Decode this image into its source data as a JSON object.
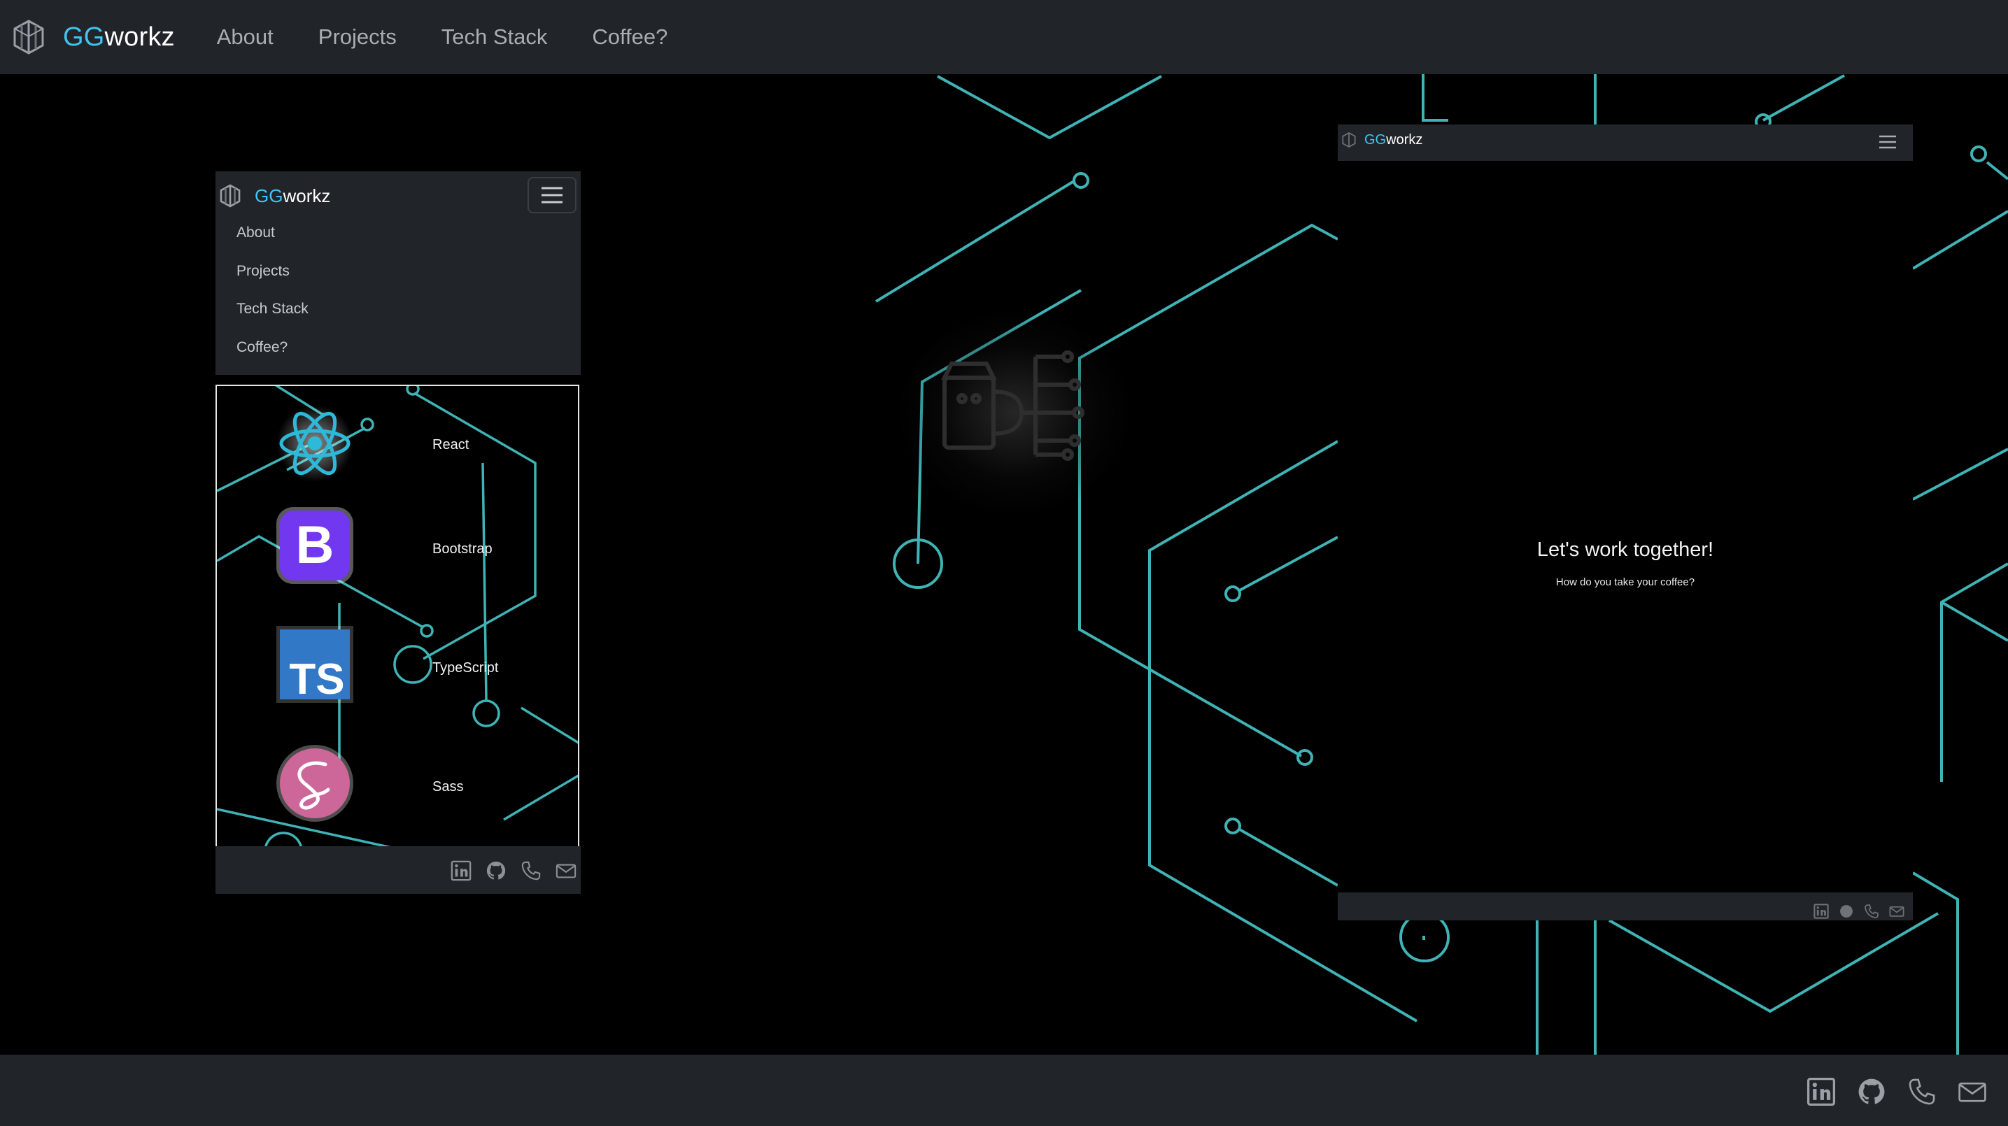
{
  "navbar": {
    "brand_gg": "GG",
    "brand_rest": "workz",
    "links": [
      "About",
      "Projects",
      "Tech Stack",
      "Coffee?"
    ]
  },
  "mobile_preview": {
    "brand_gg": "GG",
    "brand_rest": "workz",
    "menu": [
      "About",
      "Projects",
      "Tech Stack",
      "Coffee?"
    ],
    "tech": [
      {
        "label": "React",
        "icon": "react-icon"
      },
      {
        "label": "Bootstrap",
        "icon": "bootstrap-icon"
      },
      {
        "label": "TypeScript",
        "icon": "typescript-icon"
      },
      {
        "label": "Sass",
        "icon": "sass-icon"
      }
    ]
  },
  "desktop_preview": {
    "brand_gg": "GG",
    "brand_rest": "workz",
    "headline": "Let's work together!",
    "subtext": "How do you take your coffee?"
  },
  "footer_icons": [
    "linkedin-icon",
    "github-icon",
    "phone-icon",
    "email-icon"
  ],
  "colors": {
    "navbar_bg": "#212529",
    "accent_blue": "#3ec6f0",
    "circuit_teal": "#3fb3b5",
    "background": "#000000"
  },
  "coffee_graphic": {
    "icon": "coffee-circuit-icon",
    "tech_logos": {
      "bootstrap_letter": "B",
      "typescript_letters": "TS"
    }
  }
}
